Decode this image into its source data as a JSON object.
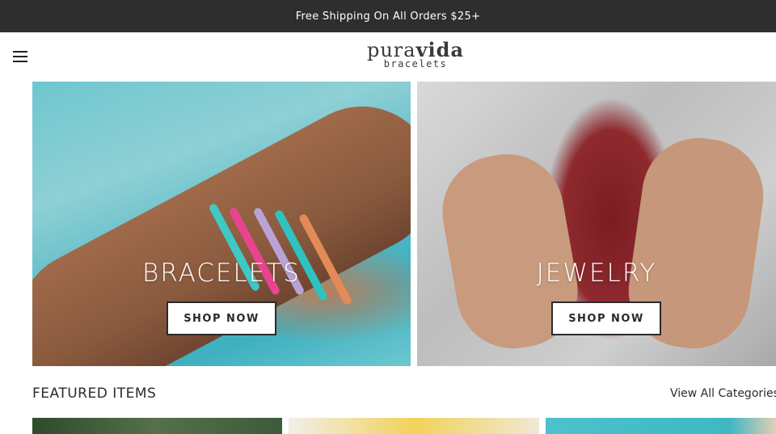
{
  "announcement": {
    "text": "Free Shipping On All Orders $25+"
  },
  "header": {
    "menu_icon": "hamburger-menu-icon",
    "logo": {
      "word_left": "pura",
      "word_right": "vida",
      "sub": "bracelets"
    }
  },
  "heroes": [
    {
      "title": "BRACELETS",
      "button": "SHOP NOW"
    },
    {
      "title": "JEWELRY",
      "button": "SHOP NOW"
    }
  ],
  "featured": {
    "title": "FEATURED ITEMS",
    "view_all": "View All Categories"
  }
}
